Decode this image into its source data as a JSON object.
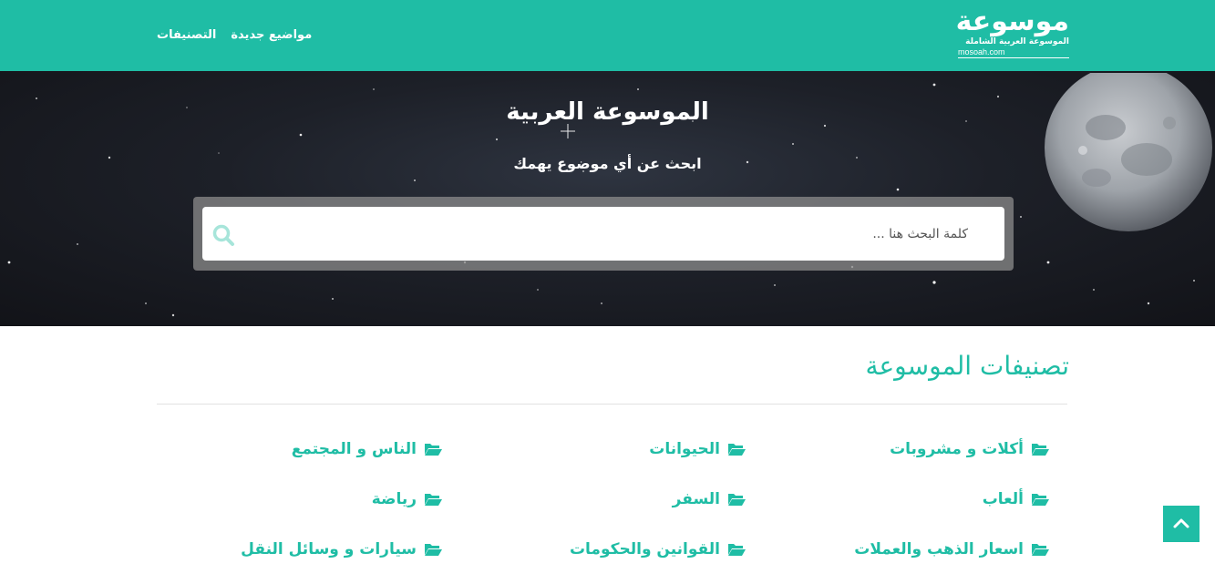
{
  "header": {
    "logo": {
      "main": "موسوعة",
      "subtitle": "الموسوعة العربية الشاملة",
      "url": "mosoah.com"
    },
    "nav": [
      {
        "label": "التصنيفات"
      },
      {
        "label": "مواضيع جديدة"
      }
    ],
    "color": "#1fbda5"
  },
  "hero": {
    "title": "الموسوعة العربية",
    "subtitle": "ابحث عن أي موضوع يهمك",
    "search": {
      "placeholder": "كلمة البحث هنا ...",
      "value": "",
      "icon": "search-icon"
    }
  },
  "categories": {
    "title": "تصنيفات الموسوعة",
    "icon": "folder-open-icon",
    "items": [
      {
        "label": "أكلات و مشروبات"
      },
      {
        "label": "الحيوانات"
      },
      {
        "label": "الناس و المجتمع"
      },
      {
        "label": "ألعاب"
      },
      {
        "label": "السفر"
      },
      {
        "label": "رياضة"
      },
      {
        "label": "اسعار الذهب والعملات"
      },
      {
        "label": "القوانين والحكومات"
      },
      {
        "label": "سيارات و وسائل النقل"
      }
    ]
  },
  "back_to_top": {
    "icon": "chevron-up-icon"
  }
}
